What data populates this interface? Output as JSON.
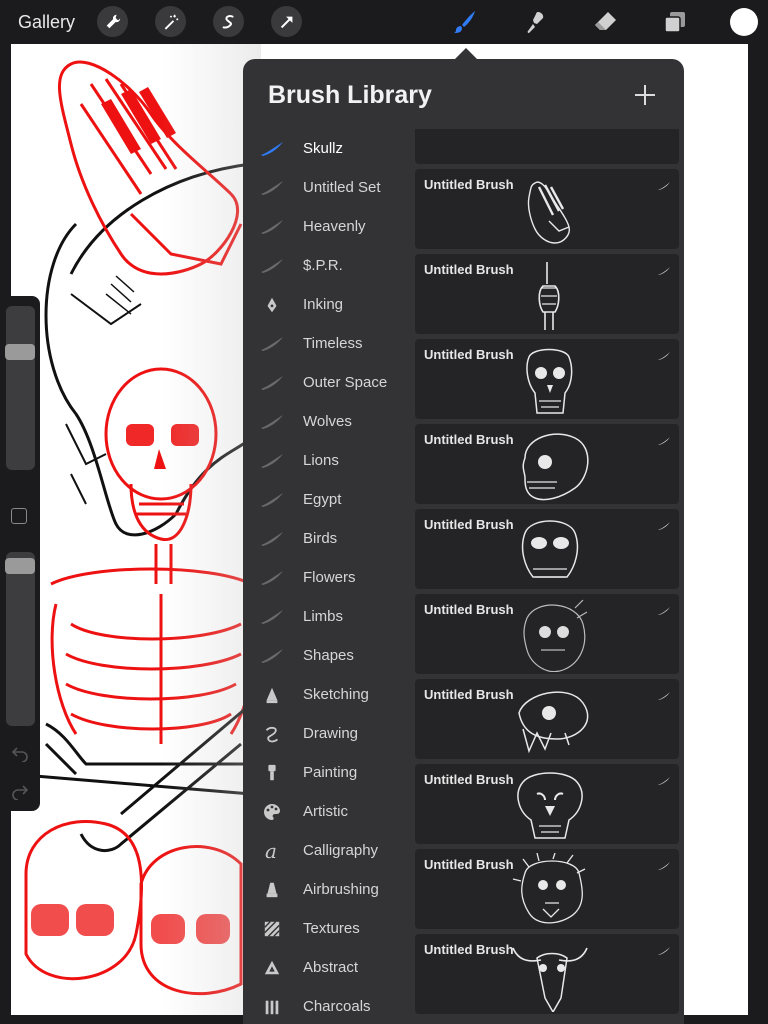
{
  "toolbar": {
    "gallery_label": "Gallery",
    "left_tools": [
      "wrench-icon",
      "magic-wand-icon",
      "selection-icon",
      "transform-arrow-icon"
    ],
    "right_tools": [
      "brush-icon",
      "smudge-icon",
      "eraser-icon",
      "layers-icon"
    ],
    "active_tool": "brush-icon",
    "accent_color": "#2f7cf6",
    "current_color": "#ffffff"
  },
  "popover": {
    "title": "Brush Library"
  },
  "sets": [
    {
      "label": "Skullz",
      "icon": "stroke-icon",
      "active": true
    },
    {
      "label": "Untitled Set",
      "icon": "stroke-icon"
    },
    {
      "label": "Heavenly",
      "icon": "stroke-icon"
    },
    {
      "label": "$.P.R.",
      "icon": "stroke-icon"
    },
    {
      "label": "Inking",
      "icon": "pen-nib-icon"
    },
    {
      "label": "Timeless",
      "icon": "stroke-icon"
    },
    {
      "label": "Outer Space",
      "icon": "stroke-icon"
    },
    {
      "label": "Wolves",
      "icon": "stroke-icon"
    },
    {
      "label": "Lions",
      "icon": "stroke-icon"
    },
    {
      "label": "Egypt",
      "icon": "stroke-icon"
    },
    {
      "label": "Birds",
      "icon": "stroke-icon"
    },
    {
      "label": "Flowers",
      "icon": "stroke-icon"
    },
    {
      "label": "Limbs",
      "icon": "stroke-icon"
    },
    {
      "label": "Shapes",
      "icon": "stroke-icon"
    },
    {
      "label": "Sketching",
      "icon": "pencil-tip-icon"
    },
    {
      "label": "Drawing",
      "icon": "squiggle-icon"
    },
    {
      "label": "Painting",
      "icon": "paintbrush-icon"
    },
    {
      "label": "Artistic",
      "icon": "palette-icon"
    },
    {
      "label": "Calligraphy",
      "icon": "calligraphy-icon"
    },
    {
      "label": "Airbrushing",
      "icon": "airbrush-icon"
    },
    {
      "label": "Textures",
      "icon": "texture-icon"
    },
    {
      "label": "Abstract",
      "icon": "triangle-icon"
    },
    {
      "label": "Charcoals",
      "icon": "charcoal-icon"
    }
  ],
  "brushes": [
    {
      "name": "",
      "preview": "skeleton-hand-icon"
    },
    {
      "name": "Untitled Brush",
      "preview": "praying-hands-icon"
    },
    {
      "name": "Untitled Brush",
      "preview": "middle-finger-icon"
    },
    {
      "name": "Untitled Brush",
      "preview": "ape-skull-front-icon"
    },
    {
      "name": "Untitled Brush",
      "preview": "ape-skull-side-icon"
    },
    {
      "name": "Untitled Brush",
      "preview": "gorilla-skull-icon"
    },
    {
      "name": "Untitled Brush",
      "preview": "monster-head-icon"
    },
    {
      "name": "Untitled Brush",
      "preview": "big-cat-skull-side-icon"
    },
    {
      "name": "Untitled Brush",
      "preview": "big-cat-skull-front-icon"
    },
    {
      "name": "Untitled Brush",
      "preview": "lion-head-icon"
    },
    {
      "name": "Untitled Brush",
      "preview": "bull-skull-icon"
    }
  ]
}
